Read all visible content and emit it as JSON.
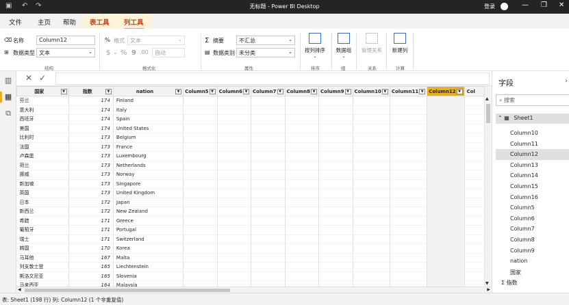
{
  "titlebar": {
    "title": "无标题 - Power BI Desktop",
    "login": "登录",
    "save_icon": "save-icon",
    "undo_icon": "undo-icon",
    "redo_icon": "redo-icon",
    "minimize": "—",
    "maximize": "❐",
    "close": "✕"
  },
  "tabs": [
    {
      "label": "文件"
    },
    {
      "label": "主页"
    },
    {
      "label": "帮助"
    },
    {
      "label": "表工具"
    },
    {
      "label": "列工具"
    }
  ],
  "ribbon": {
    "name_label": "名称",
    "name_value": "Column12",
    "datatype_label": "数据类型",
    "datatype_value": "文本",
    "group_structure": "结构",
    "format_label": "格式",
    "format_value": "文本",
    "currency": "$",
    "percent": "%",
    "comma": "9",
    "decimals": ".00",
    "auto": "自动",
    "group_format": "格式化",
    "summary_label": "摘要",
    "summary_value": "不汇总",
    "category_label": "数据类别",
    "category_value": "未分类",
    "group_properties": "属性",
    "sort_by_column": "按列排序",
    "group_sort": "排序",
    "data_groups": "数据组",
    "group_groups": "组",
    "manage_relationships": "管理关系",
    "group_relationships": "关系",
    "new_column": "新建列",
    "group_calculations": "计算"
  },
  "formula": {
    "cancel": "✕",
    "commit": "✓"
  },
  "grid": {
    "columns": [
      "国家",
      "指数",
      "nation",
      "Column5",
      "Column6",
      "Column7",
      "Column8",
      "Column9",
      "Column10",
      "Column11",
      "Column12",
      "Col"
    ],
    "selected_column": "Column12",
    "rows": [
      [
        "芬兰",
        "174",
        "Finland"
      ],
      [
        "意大利",
        "174",
        "Italy"
      ],
      [
        "西班牙",
        "174",
        "Spain"
      ],
      [
        "美国",
        "174",
        "United States"
      ],
      [
        "比利时",
        "173",
        "Belgium"
      ],
      [
        "法国",
        "173",
        "France"
      ],
      [
        "卢森堡",
        "173",
        "Luxembourg"
      ],
      [
        "荷兰",
        "173",
        "Netherlands"
      ],
      [
        "挪威",
        "173",
        "Norway"
      ],
      [
        "新加坡",
        "173",
        "Singapore"
      ],
      [
        "英国",
        "173",
        "United Kingdom"
      ],
      [
        "日本",
        "172",
        "Japan"
      ],
      [
        "新西兰",
        "172",
        "New Zealand"
      ],
      [
        "希腊",
        "171",
        "Greece"
      ],
      [
        "葡萄牙",
        "171",
        "Portugal"
      ],
      [
        "瑞士",
        "171",
        "Switzerland"
      ],
      [
        "韩国",
        "170",
        "Korea"
      ],
      [
        "马耳他",
        "167",
        "Malta"
      ],
      [
        "列支敦士登",
        "165",
        "Liechtenstein"
      ],
      [
        "斯洛文尼亚",
        "165",
        "Slovenia"
      ],
      [
        "马来西亚",
        "164",
        "Malaysia"
      ]
    ]
  },
  "fields": {
    "title": "字段",
    "search_placeholder": "搜索",
    "table_name": "Sheet1",
    "items": [
      "Column10",
      "Column11",
      "Column12",
      "Column13",
      "Column14",
      "Column15",
      "Column16",
      "Column5",
      "Column6",
      "Column7",
      "Column8",
      "Column9",
      "nation",
      "国家",
      "指数"
    ],
    "selected": "Column12"
  },
  "status": {
    "text": "表: Sheet1 (198 行) 列: Column12 (1 个非重复值)"
  },
  "colors": {
    "accent": "#e8b021",
    "context_tab": "#c43e1c",
    "titlebar": "#252423"
  }
}
